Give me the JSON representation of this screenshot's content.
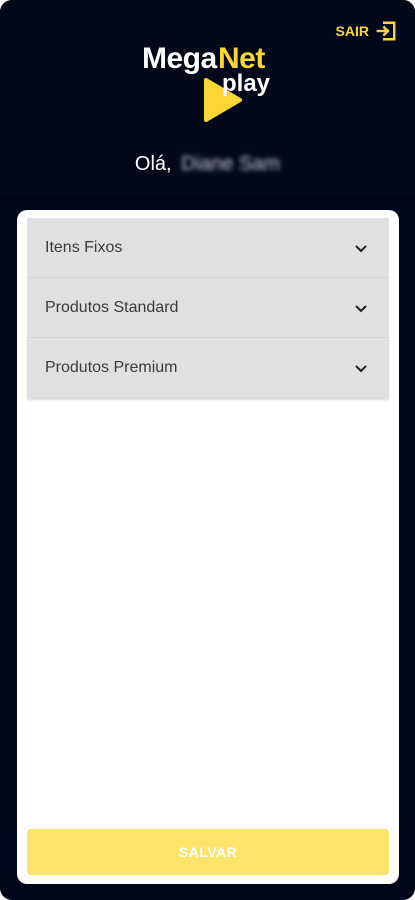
{
  "header": {
    "logout_label": "SAIR",
    "logout_icon": "logout-icon",
    "logo": {
      "word1": "Mega",
      "word2": "Net",
      "word3": "play"
    },
    "greeting_prefix": "Olá,",
    "user_name": "Diane Sam"
  },
  "accordion": {
    "items": [
      {
        "label": "Itens Fixos",
        "icon": "chevron-down-icon"
      },
      {
        "label": "Produtos Standard",
        "icon": "chevron-down-icon"
      },
      {
        "label": "Produtos Premium",
        "icon": "chevron-down-icon"
      }
    ]
  },
  "footer": {
    "save_label": "SALVAR"
  },
  "colors": {
    "background": "#00051a",
    "accent": "#fbd635",
    "save_button": "#fde36a",
    "accordion_bg": "#e0e0e0"
  }
}
